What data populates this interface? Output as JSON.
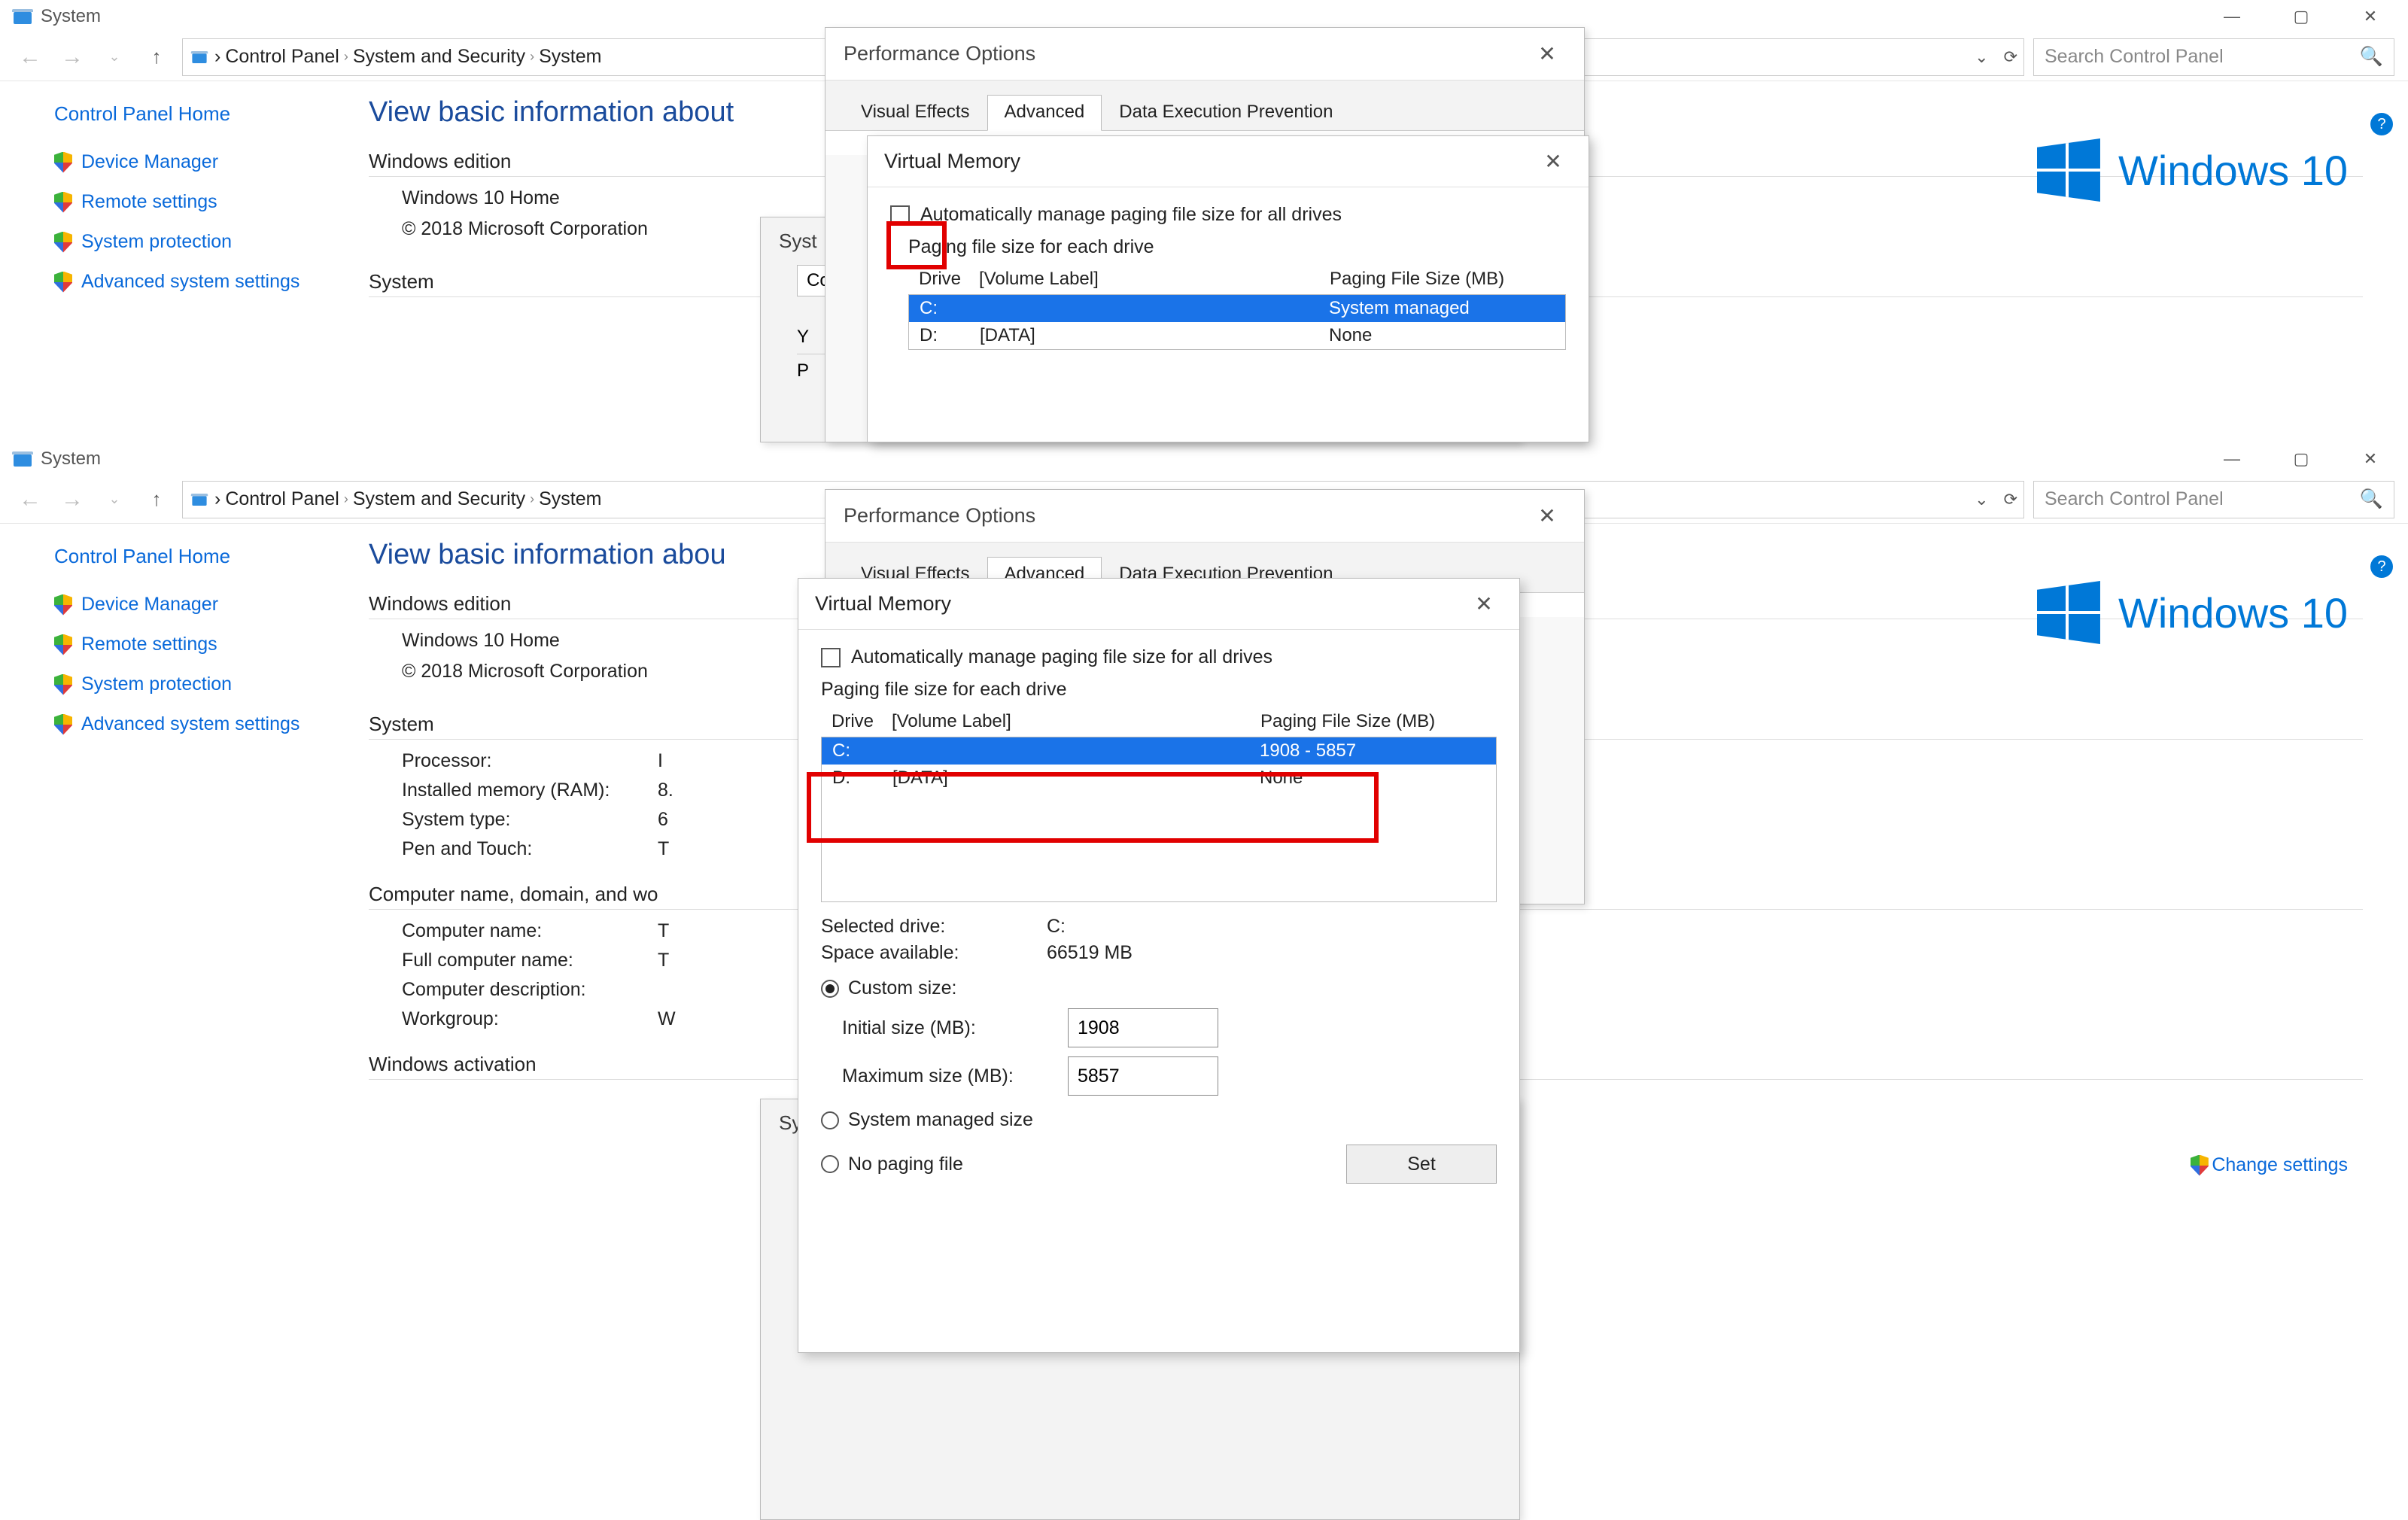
{
  "titlebar": {
    "title": "System"
  },
  "breadcrumb": {
    "items": [
      "Control Panel",
      "System and Security",
      "System"
    ]
  },
  "search": {
    "placeholder": "Search Control Panel"
  },
  "sidebar": {
    "home": "Control Panel Home",
    "links": [
      "Device Manager",
      "Remote settings",
      "System protection",
      "Advanced system settings"
    ]
  },
  "main": {
    "title_full": "View basic information about your computer",
    "title_trunc_top": "View basic information about",
    "title_trunc_bot": "View basic information abou",
    "winedition_h": "Windows edition",
    "winedition_name": "Windows 10 Home",
    "winedition_copy": "© 2018 Microsoft Corporation",
    "system_h": "System",
    "system_rows": [
      {
        "k": "Processor:",
        "v": "I"
      },
      {
        "k": "Installed memory (RAM):",
        "v": "8."
      },
      {
        "k": "System type:",
        "v": "6"
      },
      {
        "k": "Pen and Touch:",
        "v": "T"
      }
    ],
    "compname_h": "Computer name, domain, and wo",
    "compname_rows": [
      {
        "k": "Computer name:",
        "v": "T"
      },
      {
        "k": "Full computer name:",
        "v": "T"
      },
      {
        "k": "Computer description:",
        "v": ""
      },
      {
        "k": "Workgroup:",
        "v": "W"
      }
    ],
    "activation_h": "Windows activation",
    "change_settings": "Change settings",
    "winlogo_text": "Windows 10"
  },
  "sysprop": {
    "title": "System Properties",
    "tab_label": "Co",
    "y_label": "Y",
    "p_label": "P"
  },
  "perf": {
    "title": "Performance Options",
    "tabs": [
      "Visual Effects",
      "Advanced",
      "Data Execution Prevention"
    ],
    "active_tab": 1
  },
  "vm": {
    "title": "Virtual Memory",
    "auto_label": "Automatically manage paging file size for all drives",
    "auto_checked": false,
    "subhead": "Paging file size for each drive",
    "col_drive": "Drive",
    "col_vol": "[Volume Label]",
    "col_size": "Paging File Size (MB)",
    "rows_top": [
      {
        "drive": "C:",
        "vol": "",
        "size": "System managed",
        "sel": true
      },
      {
        "drive": "D:",
        "vol": "[DATA]",
        "size": "None",
        "sel": false
      }
    ],
    "rows_bot": [
      {
        "drive": "C:",
        "vol": "",
        "size": "1908 - 5857",
        "sel": true
      },
      {
        "drive": "D:",
        "vol": "[DATA]",
        "size": "None",
        "sel": false
      }
    ],
    "selected_drive_k": "Selected drive:",
    "selected_drive_v": "C:",
    "space_k": "Space available:",
    "space_v": "66519 MB",
    "custom_label": "Custom size:",
    "initial_k": "Initial size (MB):",
    "initial_v": "1908",
    "max_k": "Maximum size (MB):",
    "max_v": "5857",
    "sysmanaged_label": "System managed size",
    "nopaging_label": "No paging file",
    "set_label": "Set"
  }
}
